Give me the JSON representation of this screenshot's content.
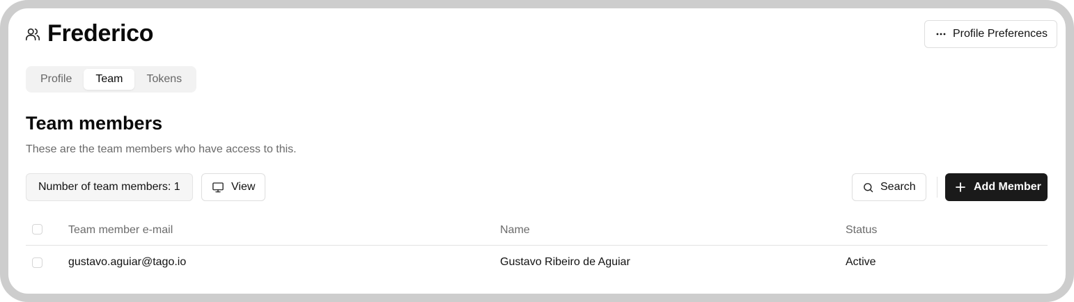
{
  "header": {
    "title": "Frederico",
    "title_icon": "users-icon",
    "preferences_label": "Profile Preferences",
    "preferences_icon": "ellipsis-icon"
  },
  "tabs": [
    {
      "label": "Profile",
      "active": false
    },
    {
      "label": "Team",
      "active": true
    },
    {
      "label": "Tokens",
      "active": false
    }
  ],
  "section": {
    "title": "Team members",
    "description": "These are the team members who have access to this."
  },
  "toolbar": {
    "count_label": "Number of team members: 1",
    "view_label": "View",
    "view_icon": "monitor-icon",
    "search_label": "Search",
    "search_icon": "search-icon",
    "add_label": "Add Member",
    "add_icon": "plus-icon",
    "add_button_color": "#1a1a1a"
  },
  "table": {
    "columns": [
      "Team member e-mail",
      "Name",
      "Status"
    ],
    "rows": [
      {
        "email": "gustavo.aguiar@tago.io",
        "name": "Gustavo Ribeiro de Aguiar",
        "status": "Active"
      }
    ]
  }
}
